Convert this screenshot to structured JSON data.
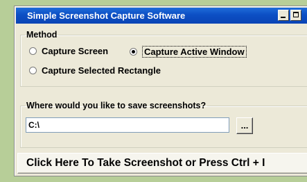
{
  "window": {
    "title": "Simple Screenshot Capture Software"
  },
  "method": {
    "legend": "Method",
    "options": [
      {
        "label": "Capture Screen",
        "selected": false
      },
      {
        "label": "Capture Active Window",
        "selected": true
      },
      {
        "label": "Capture Selected Rectangle",
        "selected": false
      }
    ]
  },
  "save": {
    "legend": "Where would you like to save screenshots?",
    "path": "C:\\",
    "browse_label": "..."
  },
  "capture_button": {
    "label": "Click Here To Take Screenshot or Press Ctrl + I"
  },
  "colors": {
    "titlebar": "#0c4fc4",
    "window_bg": "#ece9d8",
    "desktop_bg": "#b7ce98"
  }
}
